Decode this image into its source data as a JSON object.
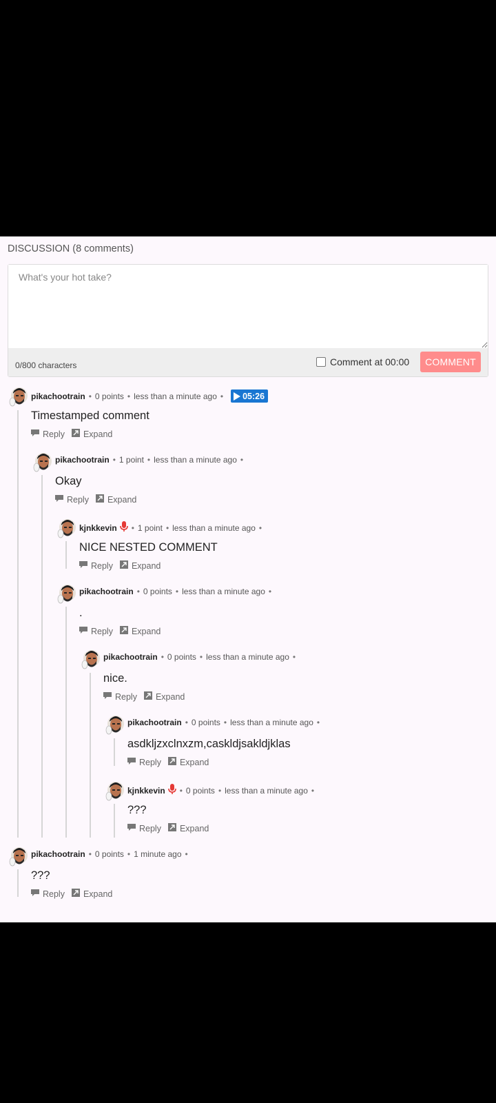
{
  "discussion": {
    "header": "DISCUSSION (8 comments)",
    "placeholder": "What's your hot take?",
    "char_count": "0/800 characters",
    "timestamp_label": "Comment at 00:00",
    "comment_button": "COMMENT"
  },
  "labels": {
    "reply": "Reply",
    "expand": "Expand",
    "dot": "•"
  },
  "comments": [
    {
      "user": "pikachootrain",
      "points": "0 points",
      "time": "less than a minute ago",
      "text": "Timestamped comment",
      "badge": "05:26"
    },
    {
      "user": "pikachootrain",
      "points": "1 point",
      "time": "less than a minute ago",
      "text": "Okay"
    },
    {
      "user": "kjnkkevin",
      "points": "1 point",
      "time": "less than a minute ago",
      "text": "NICE NESTED COMMENT"
    },
    {
      "user": "pikachootrain",
      "points": "0 points",
      "time": "less than a minute ago",
      "text": "."
    },
    {
      "user": "pikachootrain",
      "points": "0 points",
      "time": "less than a minute ago",
      "text": "nice."
    },
    {
      "user": "pikachootrain",
      "points": "0 points",
      "time": "less than a minute ago",
      "text": "asdkljzxclnxzm,caskldjsakldjklas"
    },
    {
      "user": "kjnkkevin",
      "points": "0 points",
      "time": "less than a minute ago",
      "text": "???"
    },
    {
      "user": "pikachootrain",
      "points": "0 points",
      "time": "1 minute ago",
      "text": "???"
    }
  ],
  "colors": {
    "accent_blue": "#1976d2",
    "comment_button": "#ff8c8c",
    "mic_red": "#e53935"
  }
}
